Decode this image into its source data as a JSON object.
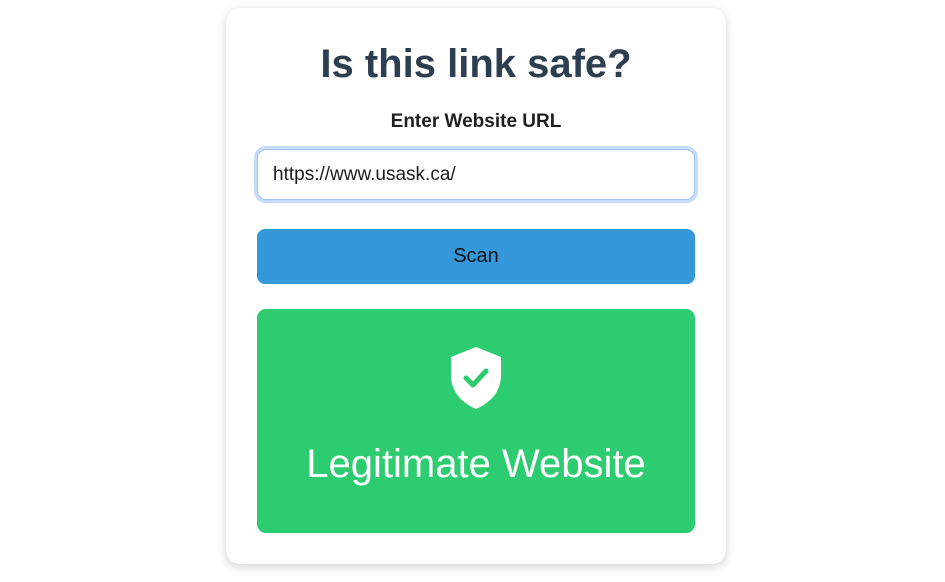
{
  "page": {
    "title": "Is this link safe?",
    "url_label": "Enter Website URL",
    "url_value": "https://www.usask.ca/",
    "scan_label": "Scan"
  },
  "result": {
    "icon": "shield-check-icon",
    "text": "Legitimate Website",
    "color": "#2ecc71"
  },
  "colors": {
    "title": "#2c3e50",
    "button": "#3498db"
  }
}
